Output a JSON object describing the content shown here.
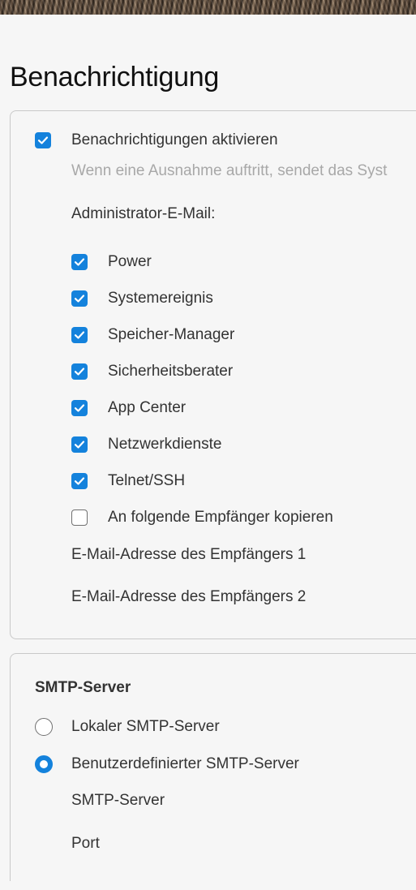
{
  "page": {
    "title": "Benachrichtigung"
  },
  "notifications": {
    "enable_label": "Benachrichtigungen aktivieren",
    "enable_checked": true,
    "hint": "Wenn eine Ausnahme auftritt, sendet das Syst",
    "admin_email_label": "Administrator-E-Mail:",
    "categories": [
      {
        "label": "Power",
        "checked": true
      },
      {
        "label": "Systemereignis",
        "checked": true
      },
      {
        "label": "Speicher-Manager",
        "checked": true
      },
      {
        "label": "Sicherheitsberater",
        "checked": true
      },
      {
        "label": "App Center",
        "checked": true
      },
      {
        "label": "Netzwerkdienste",
        "checked": true
      },
      {
        "label": "Telnet/SSH",
        "checked": true
      }
    ],
    "copy_label": "An folgende Empfänger kopieren",
    "copy_checked": false,
    "recipient1_label": "E-Mail-Adresse des Empfängers 1",
    "recipient2_label": "E-Mail-Adresse des Empfängers 2"
  },
  "smtp": {
    "section_title": "SMTP-Server",
    "options": [
      {
        "label": "Lokaler SMTP-Server",
        "selected": false
      },
      {
        "label": "Benutzerdefinierter SMTP-Server",
        "selected": true
      }
    ],
    "server_label": "SMTP-Server",
    "port_label": "Port"
  },
  "colors": {
    "accent": "#1482dc",
    "hint_text": "#a8a8a8"
  }
}
